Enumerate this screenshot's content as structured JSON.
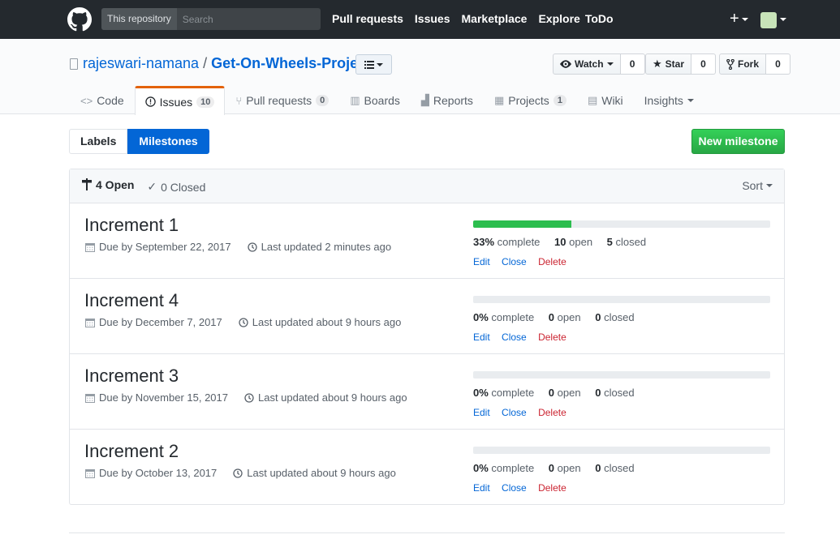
{
  "header": {
    "search_scope": "This repository",
    "search_placeholder": "Search",
    "nav": [
      "Pull requests",
      "Issues",
      "Marketplace",
      "Explore",
      "ToDo"
    ],
    "plus_label": "+"
  },
  "repo": {
    "owner": "rajeswari-namana",
    "separator": "/",
    "name": "Get-On-Wheels-Project",
    "watch": {
      "label": "Watch",
      "count": "0"
    },
    "star": {
      "label": "Star",
      "count": "0"
    },
    "fork": {
      "label": "Fork",
      "count": "0"
    }
  },
  "tabs": [
    {
      "label": "Code",
      "icon": "code-icon"
    },
    {
      "label": "Issues",
      "icon": "issue-icon",
      "count": "10",
      "selected": true
    },
    {
      "label": "Pull requests",
      "icon": "pr-icon",
      "count": "0"
    },
    {
      "label": "Boards",
      "icon": "boards-icon"
    },
    {
      "label": "Reports",
      "icon": "reports-icon"
    },
    {
      "label": "Projects",
      "icon": "projects-icon",
      "count": "1"
    },
    {
      "label": "Wiki",
      "icon": "wiki-icon"
    },
    {
      "label": "Insights",
      "icon": "none"
    }
  ],
  "subnav": {
    "labels": "Labels",
    "milestones": "Milestones",
    "new_milestone": "New milestone"
  },
  "list_header": {
    "open": "4 Open",
    "closed": "0 Closed",
    "sort": "Sort"
  },
  "milestones": [
    {
      "title": "Increment 1",
      "due": "Due by September 22, 2017",
      "updated": "Last updated 2 minutes ago",
      "percent_value": 33,
      "percent": "33%",
      "complete_label": "complete",
      "open": "10",
      "open_label": "open",
      "closed": "5",
      "closed_label": "closed"
    },
    {
      "title": "Increment 4",
      "due": "Due by December 7, 2017",
      "updated": "Last updated about 9 hours ago",
      "percent_value": 0,
      "percent": "0%",
      "complete_label": "complete",
      "open": "0",
      "open_label": "open",
      "closed": "0",
      "closed_label": "closed"
    },
    {
      "title": "Increment 3",
      "due": "Due by November 15, 2017",
      "updated": "Last updated about 9 hours ago",
      "percent_value": 0,
      "percent": "0%",
      "complete_label": "complete",
      "open": "0",
      "open_label": "open",
      "closed": "0",
      "closed_label": "closed"
    },
    {
      "title": "Increment 2",
      "due": "Due by October 13, 2017",
      "updated": "Last updated about 9 hours ago",
      "percent_value": 0,
      "percent": "0%",
      "complete_label": "complete",
      "open": "0",
      "open_label": "open",
      "closed": "0",
      "closed_label": "closed"
    }
  ],
  "row_actions": {
    "edit": "Edit",
    "close": "Close",
    "delete": "Delete"
  },
  "colors": {
    "accent": "#0366d6",
    "success": "#28a745",
    "danger": "#cb2431",
    "header_bg": "#24292e",
    "tab_accent": "#e36209"
  }
}
